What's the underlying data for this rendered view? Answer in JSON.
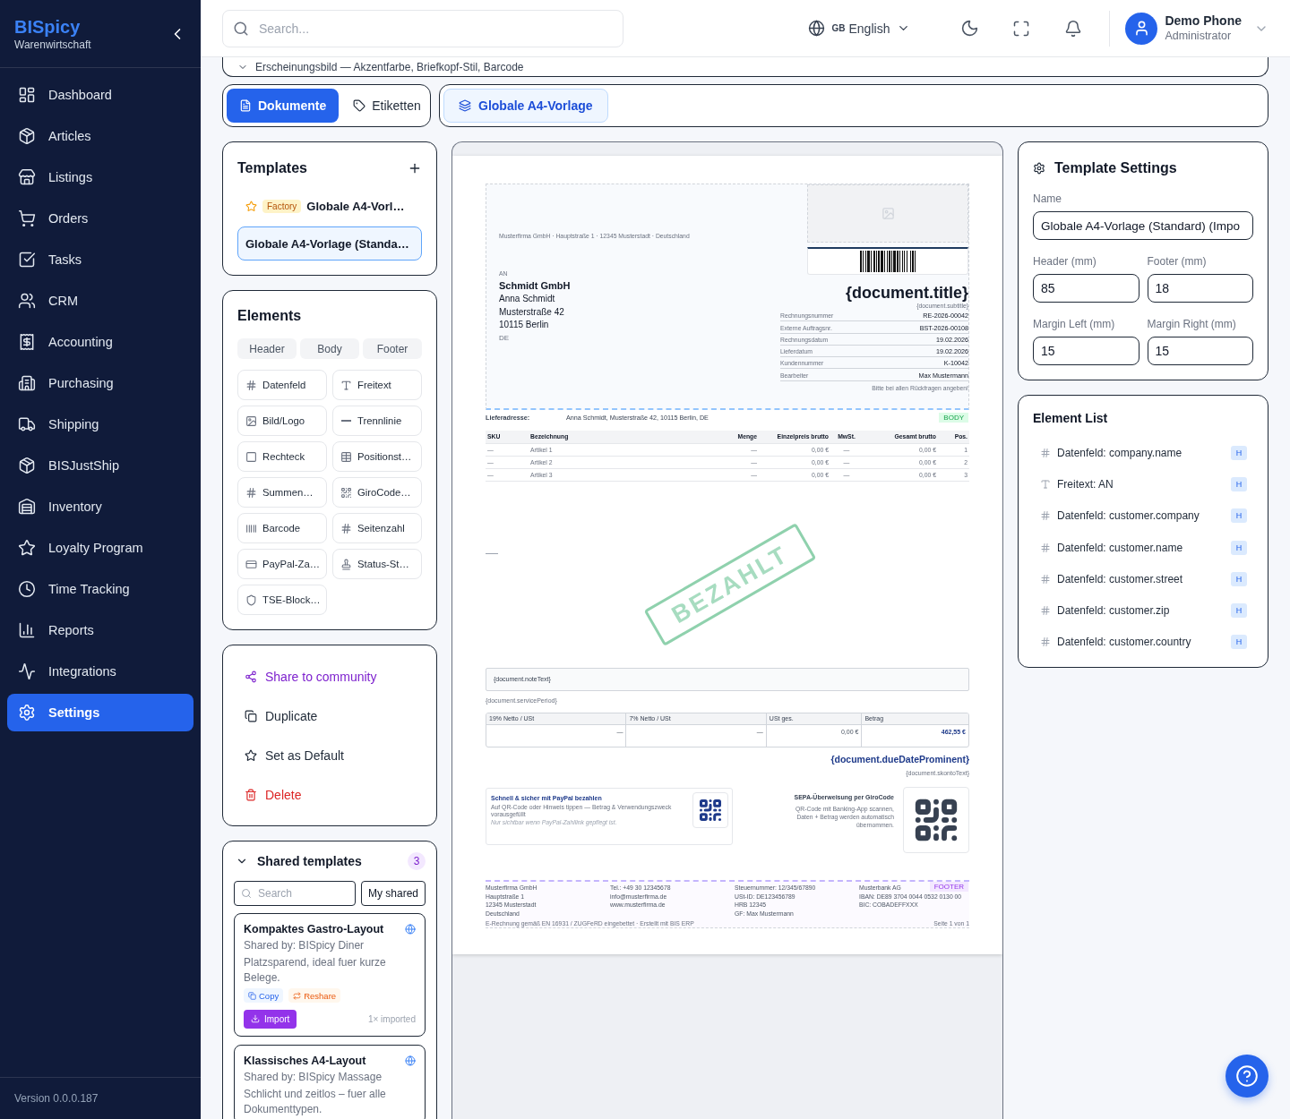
{
  "sidebar": {
    "brand": "BISpicy",
    "subtitle": "Warenwirtschaft",
    "items": [
      {
        "label": "Dashboard",
        "selected": false
      },
      {
        "label": "Articles",
        "selected": false
      },
      {
        "label": "Listings",
        "selected": false
      },
      {
        "label": "Orders",
        "selected": false
      },
      {
        "label": "Tasks",
        "selected": false
      },
      {
        "label": "CRM",
        "selected": false
      },
      {
        "label": "Accounting",
        "selected": false
      },
      {
        "label": "Purchasing",
        "selected": false
      },
      {
        "label": "Shipping",
        "selected": false
      },
      {
        "label": "BISJustShip",
        "selected": false
      },
      {
        "label": "Inventory",
        "selected": false
      },
      {
        "label": "Loyalty Program",
        "selected": false
      },
      {
        "label": "Time Tracking",
        "selected": false
      },
      {
        "label": "Reports",
        "selected": false
      },
      {
        "label": "Integrations",
        "selected": false
      },
      {
        "label": "Settings",
        "selected": true
      }
    ],
    "version": "Version 0.0.0.187"
  },
  "topbar": {
    "search": {
      "placeholder": "Search..."
    },
    "language": {
      "flag": "GB",
      "label": "English"
    },
    "user": {
      "name": "Demo Phone",
      "role": "Administrator"
    }
  },
  "appearance_section": {
    "title": "Erscheinungsbild — Akzentfarbe, Briefkopf-Stil, Barcode"
  },
  "mode_tabs": [
    {
      "label": "Dokumente",
      "selected": true
    },
    {
      "label": "Etiketten",
      "selected": false
    }
  ],
  "template_chips": [
    {
      "label": "Globale A4-Vorlage",
      "selected": true
    }
  ],
  "templates": {
    "title": "Templates",
    "items": [
      {
        "name": "Globale A4-Vorl…",
        "badge": "Factory",
        "default": true,
        "selected": false
      },
      {
        "name": "Globale A4-Vorlage (Standa…",
        "default": false,
        "selected": true
      }
    ]
  },
  "elements": {
    "title": "Elements",
    "sections": [
      {
        "label": "Header",
        "selected": false
      },
      {
        "label": "Body",
        "selected": false
      },
      {
        "label": "Footer",
        "selected": false
      }
    ],
    "items": [
      "Datenfeld",
      "Freitext",
      "Bild/Logo",
      "Trennlinie",
      "Rechteck",
      "Positionst…",
      "Summen…",
      "GiroCode…",
      "Barcode",
      "Seitenzahl",
      "PayPal-Za…",
      "Status-St…",
      "TSE-Block…"
    ]
  },
  "actions": [
    {
      "label": "Share to community",
      "kind": "share"
    },
    {
      "label": "Duplicate",
      "kind": "duplicate"
    },
    {
      "label": "Set as Default",
      "kind": "default"
    },
    {
      "label": "Delete",
      "kind": "delete"
    }
  ],
  "shared": {
    "title": "Shared templates",
    "count": "3",
    "expanded": true,
    "search": {
      "placeholder": "Search"
    },
    "filter_button": "My shared",
    "cards": [
      {
        "title": "Kompaktes Gastro-Layout",
        "shared_by": "Shared by: BISpicy Diner",
        "description": "Platzsparend, ideal fuer kurze Belege.",
        "actions": [
          {
            "label": "Copy",
            "kind": "copy"
          },
          {
            "label": "Reshare",
            "kind": "reshare"
          }
        ],
        "import": "Import",
        "imported": "1× imported"
      },
      {
        "title": "Klassisches A4-Layout",
        "shared_by": "Shared by: BISpicy Massage",
        "description": "Schlicht und zeitlos – fuer alle Dokumenttypen."
      }
    ]
  },
  "preview": {
    "sender_line": "Musterfirma GmbH · Hauptstraße 1 · 12345 Musterstadt · Deutschland",
    "recipient": {
      "label": "AN",
      "company": "Schmidt GmbH",
      "lines": [
        "Anna Schmidt",
        "Musterstraße 42",
        "10115 Berlin"
      ],
      "country": "DE"
    },
    "title": "{document.title}",
    "subtitle": "{document.subtitle}",
    "info_rows": [
      {
        "label": "Rechnungsnummer",
        "value": "RE-2026-00042"
      },
      {
        "label": "Externe Auftragsnr.",
        "value": "BST-2026-00108"
      },
      {
        "label": "Rechnungsdatum",
        "value": "19.02.2026"
      },
      {
        "label": "Lieferdatum",
        "value": "19.02.2026"
      },
      {
        "label": "Kundennummer",
        "value": "K-10042"
      },
      {
        "label": "Bearbeiter",
        "value": "Max Mustermann"
      }
    ],
    "info_note": "Bitte bei allen Rückfragen angeben!",
    "delivery": {
      "label": "Lieferadresse:",
      "value": "Anna Schmidt, Musterstraße 42, 10115 Berlin, DE"
    },
    "body_tag": "BODY",
    "items_table": {
      "columns": [
        "SKU",
        "Bezeichnung",
        "Menge",
        "Einzelpreis brutto",
        "MwSt.",
        "Gesamt brutto",
        "Pos."
      ],
      "rows": [
        [
          "—",
          "Artikel 1",
          "—",
          "0,00 €",
          "—",
          "0,00 €",
          "1"
        ],
        [
          "—",
          "Artikel 2",
          "—",
          "0,00 €",
          "—",
          "0,00 €",
          "2"
        ],
        [
          "—",
          "Artikel 3",
          "—",
          "0,00 €",
          "—",
          "0,00 €",
          "3"
        ]
      ]
    },
    "stamp": "BEZAHLT",
    "note": "{document.noteText}",
    "service_period": "{document.servicePeriod}",
    "totals": {
      "columns": [
        "19% Netto / USt",
        "7% Netto / USt",
        "USt ges.",
        "Betrag"
      ],
      "values": [
        "—",
        "—",
        "0,00 €",
        "462,55 €"
      ]
    },
    "due_date": "{document.dueDateProminent}",
    "skonto": "{document.skontoText}",
    "paypal": {
      "title": "Schnell & sicher mit PayPal bezahlen",
      "text": "Auf QR-Code oder Hinweis tippen — Betrag & Verwendungszweck vorausgefüllt",
      "hint": "Nur sichtbar wenn PayPal-Zahllink gepflegt ist."
    },
    "girocode": {
      "title": "SEPA-Überweisung per GiroCode",
      "text": "QR-Code mit Banking-App scannen, Daten + Betrag werden automatisch übernommen."
    },
    "footer_tag": "FOOTER",
    "footer_columns": [
      [
        "Musterfirma GmbH",
        "Hauptstraße 1",
        "12345 Musterstadt",
        "Deutschland"
      ],
      [
        "Tel.: +49 30 12345678",
        "info@musterfirma.de",
        "www.musterfirma.de"
      ],
      [
        "Steuernummer: 12/345/67890",
        "USt-ID: DE123456789",
        "HRB 12345",
        "GF: Max Mustermann"
      ],
      [
        "Musterbank AG",
        "IBAN: DE89 3704 0044 0532 0130 00",
        "BIC: COBADEFFXXX"
      ]
    ],
    "footer_note": "E-Rechnung gemäß EN 16931 / ZUGFeRD eingebettet · Erstellt mit BIS ERP",
    "page_number": "Seite 1 von 1"
  },
  "template_settings": {
    "title": "Template Settings",
    "fields": [
      {
        "label": "Name",
        "value": "Globale A4-Vorlage (Standard) (Impo"
      },
      {
        "label": "Header (mm)",
        "value": "85"
      },
      {
        "label": "Footer (mm)",
        "value": "18"
      },
      {
        "label": "Margin Left (mm)",
        "value": "15"
      },
      {
        "label": "Margin Right (mm)",
        "value": "15"
      }
    ]
  },
  "element_list": {
    "title": "Element List",
    "items": [
      {
        "label": "Datenfeld: company.name",
        "kind": "field",
        "zone": "H"
      },
      {
        "label": "Freitext: AN",
        "kind": "text",
        "zone": "H"
      },
      {
        "label": "Datenfeld: customer.company",
        "kind": "field",
        "zone": "H"
      },
      {
        "label": "Datenfeld: customer.name",
        "kind": "field",
        "zone": "H"
      },
      {
        "label": "Datenfeld: customer.street",
        "kind": "field",
        "zone": "H"
      },
      {
        "label": "Datenfeld: customer.zip",
        "kind": "field",
        "zone": "H"
      },
      {
        "label": "Datenfeld: customer.country",
        "kind": "field",
        "zone": "H"
      }
    ]
  }
}
